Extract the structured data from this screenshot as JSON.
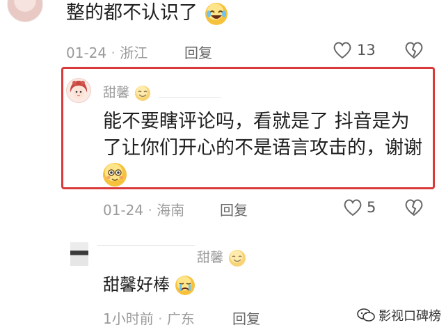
{
  "comments": [
    {
      "text": "整的都不认识了",
      "date": "01-24",
      "location": "浙江",
      "reply_label": "回复",
      "like_count": "13"
    }
  ],
  "reply1": {
    "author": "甜馨",
    "text_line1": "能不要瞎评论吗，看就是了 抖音是为",
    "text_line2": "了让你们开心的不是语言攻击的，谢谢",
    "date": "01-24",
    "location": "海南",
    "reply_label": "回复",
    "like_count": "5"
  },
  "reply2": {
    "author": "甜馨",
    "text": "甜馨好棒",
    "time": "1小时前",
    "location": "广东",
    "reply_label": "回复"
  },
  "watermark": {
    "text": "影视口碑榜"
  },
  "separator": "·",
  "colors": {
    "highlight_border": "#d93a3a",
    "meta_text": "#9a9a9a",
    "emoji_yellow": "#f6c23e"
  },
  "icons": [
    "heart-icon",
    "dislike-icon",
    "laugh-cry-emoji",
    "smile-emoji",
    "crying-emoji",
    "wechat-icon"
  ]
}
